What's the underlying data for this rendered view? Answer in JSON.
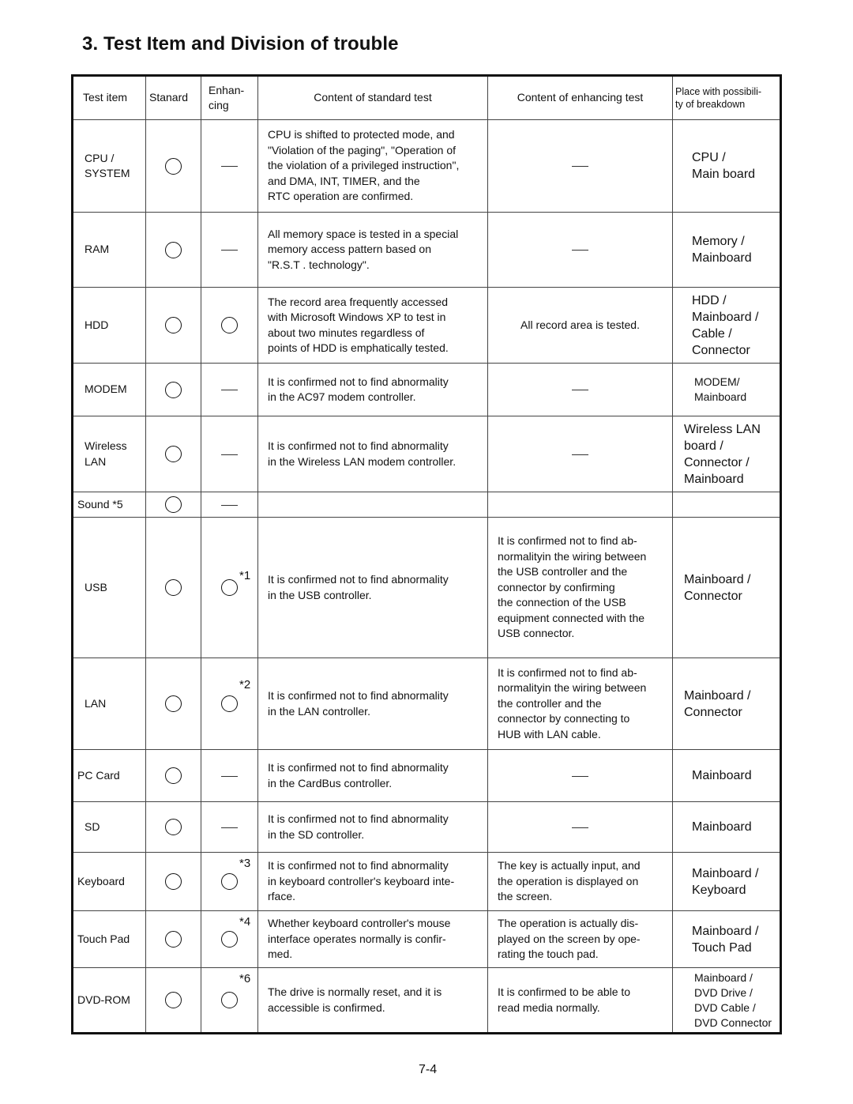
{
  "page": {
    "title": "3. Test Item and Division of trouble",
    "page_number": "7-4"
  },
  "table": {
    "headers": {
      "test_item": "Test item",
      "standard": "Stanard",
      "enhancing": "Enhan-\ncing",
      "content_standard": "Content of standard test",
      "content_enhancing": "Content of enhancing test",
      "place": "Place with possibili-\nty of breakdown"
    },
    "symbols": {
      "supported": "circle-icon",
      "not_supported": "dash-icon"
    },
    "rows": [
      {
        "item": "CPU /\nSYSTEM",
        "standard": "circle",
        "enhancing": "dash",
        "enhancing_note": "",
        "content_standard": "CPU is shifted to protected mode, and\n\"Violation of the paging\", \"Operation of\nthe violation of a privileged instruction\",\nand DMA, INT, TIMER, and the\nRTC operation are confirmed.",
        "content_enhancing": "—",
        "place": "CPU /\nMain board"
      },
      {
        "item": "RAM",
        "standard": "circle",
        "enhancing": "dash",
        "enhancing_note": "",
        "content_standard": "All memory space is tested in a special\nmemory access pattern based on\n\"R.S.T . technology\".",
        "content_enhancing": "—",
        "place": "Memory /\nMainboard"
      },
      {
        "item": "HDD",
        "standard": "circle",
        "enhancing": "circle",
        "enhancing_note": "",
        "content_standard": "The record area frequently accessed\nwith Microsoft Windows XP to test in\nabout two minutes regardless of\npoints of HDD is emphatically tested.",
        "content_enhancing": "All record area is tested.",
        "place": "HDD /\nMainboard /\nCable /\nConnector"
      },
      {
        "item": "MODEM",
        "standard": "circle",
        "enhancing": "dash",
        "enhancing_note": "",
        "content_standard": "It is confirmed not to find abnormality\nin the AC97 modem controller.",
        "content_enhancing": "—",
        "place": "MODEM/\nMainboard"
      },
      {
        "item": "Wireless\nLAN",
        "standard": "circle",
        "enhancing": "dash",
        "enhancing_note": "",
        "content_standard": "It is confirmed not to find abnormality\nin the Wireless LAN modem controller.",
        "content_enhancing": "—",
        "place": "Wireless LAN\nboard /\nConnector /\nMainboard"
      },
      {
        "item": "Sound *5",
        "standard": "circle",
        "enhancing": "dash",
        "enhancing_note": "",
        "content_standard": "",
        "content_enhancing": "",
        "place": ""
      },
      {
        "item": "USB",
        "standard": "circle",
        "enhancing": "circle",
        "enhancing_note": "*1",
        "content_standard": "It is confirmed not to find abnormality\nin the USB controller.",
        "content_enhancing": "It is confirmed not to find ab-\nnormalityin the wiring between\nthe USB controller and the\nconnector by confirming\nthe connection of the USB\nequipment connected with the\nUSB connector.",
        "place": "Mainboard /\nConnector"
      },
      {
        "item": "LAN",
        "standard": "circle",
        "enhancing": "circle",
        "enhancing_note": "*2",
        "content_standard": "It is confirmed not to find abnormality\nin the LAN controller.",
        "content_enhancing": "It is confirmed not to find ab-\nnormalityin the wiring between\nthe controller and the\nconnector by connecting to\nHUB with LAN cable.",
        "place": "Mainboard /\nConnector"
      },
      {
        "item": "PC Card",
        "standard": "circle",
        "enhancing": "dash",
        "enhancing_note": "",
        "content_standard": "It is confirmed not to find abnormality\nin the CardBus controller.",
        "content_enhancing": "—",
        "place": "Mainboard"
      },
      {
        "item": "SD",
        "standard": "circle",
        "enhancing": "dash",
        "enhancing_note": "",
        "content_standard": "It is confirmed not to find abnormality\nin the SD controller.",
        "content_enhancing": "—",
        "place": "Mainboard"
      },
      {
        "item": "Keyboard",
        "standard": "circle",
        "enhancing": "circle",
        "enhancing_note": "*3",
        "content_standard": "It is confirmed not to find abnormality\nin keyboard controller's keyboard inte-\nrface.",
        "content_enhancing": "The key is actually input, and\nthe operation is displayed on\nthe screen.",
        "place": "Mainboard /\nKeyboard"
      },
      {
        "item": "Touch Pad",
        "standard": "circle",
        "enhancing": "circle",
        "enhancing_note": "*4",
        "content_standard": "Whether keyboard controller's mouse\ninterface operates normally is confir-\nmed.",
        "content_enhancing": "The operation is actually dis-\nplayed on the screen by ope-\nrating the touch pad.",
        "place": "Mainboard /\nTouch Pad"
      },
      {
        "item": "DVD-ROM",
        "standard": "circle",
        "enhancing": "circle",
        "enhancing_note": "*6",
        "content_standard": "The drive is normally reset, and it is\naccessible is confirmed.",
        "content_enhancing": "It is confirmed to be able to\nread media normally.",
        "place": "Mainboard /\nDVD Drive /\nDVD Cable /\nDVD Connector"
      }
    ]
  }
}
